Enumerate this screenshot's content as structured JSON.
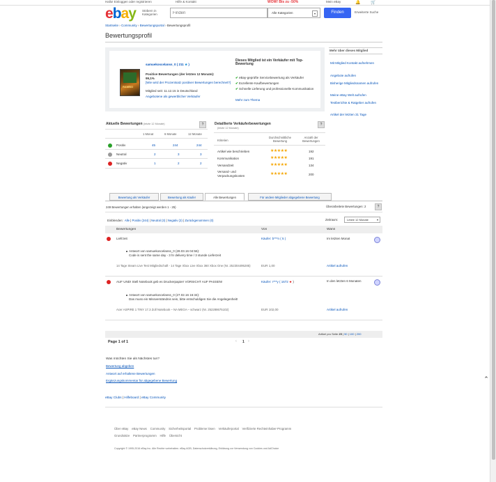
{
  "topbar": {
    "left_text": "Hallo! Einloggen oder registrieren",
    "mid_text": "Hilfe & Kontakt",
    "promo": "WOW! Bis zu -50%",
    "my_ebay": "Mein eBay"
  },
  "header": {
    "browse_label": "Stöbern in Kategorien",
    "search_placeholder": "Finden",
    "category_selected": "Alle Kategorien",
    "search_button": "Finden",
    "advanced_search": "Erweiterte Suche"
  },
  "breadcrumb": [
    "Startseite",
    "Community",
    "Bewertungsportal",
    "Bewertungsprofil"
  ],
  "page_title": "Bewertungsprofil",
  "profile": {
    "username": "samuekoscelanss_0 ( 211",
    "positive_label": "Positive Bewertungen (der letzten 12 Monate):",
    "positive_value": "99,1%",
    "positive_link": "[Wie wird der Prozentsatz positiver Bewertungen berechnet?]",
    "member_since": "Mitglied seit: 11.12.15 in Deutschland",
    "view_items": "Angebotene als gewerblicher Verkäufer",
    "top_rated_title": "Dieses Mitglied ist ein Verkäufer mit Top-Bewertung",
    "top_points": [
      "eBay-geprüfte Servicebewertung als Verkäufer",
      "Exzellente Kaufbewertungen",
      "Schnelle Lieferung und professionelle Kommunikation"
    ],
    "more_link": "Mehr zum Thema"
  },
  "more_about": {
    "title": "Mehr über dieses Mitglied",
    "links": [
      "Mit Mitglied Kontakt aufnehmen",
      "Angebote aufrufen",
      "Bisherige Mitgliedsnamen aufrufen",
      "Meine eBay Welt aufrufen",
      "Testberichte & Ratgeber aufrufen",
      "Artikel der letzten 31 Tage"
    ]
  },
  "recent": {
    "title": "Aktuelle Bewertungen",
    "subtitle": "(letzte 12 Monate)",
    "headers": [
      "1 Monat",
      "6 Monate",
      "12 Monate"
    ],
    "rows": [
      {
        "label": "Positiv",
        "v1": "45",
        "v6": "244",
        "v12": "244"
      },
      {
        "label": "Neutral",
        "v1": "2",
        "v6": "3",
        "v12": "3"
      },
      {
        "label": "Negativ",
        "v1": "1",
        "v6": "2",
        "v12": "2"
      }
    ]
  },
  "detailed": {
    "title": "Detaillierte Verkäuferbewertungen",
    "subtitle": "(letzte 12 Monate)",
    "headers": [
      "Kriterien",
      "Durchschnittliche Bewertung",
      "Anzahl der Bewertungen"
    ],
    "rows": [
      {
        "label": "Artikel wie beschrieben",
        "count": "192",
        "stars": 4.8
      },
      {
        "label": "Kommunikation",
        "count": "191",
        "stars": 4.8
      },
      {
        "label": "Versandzeit",
        "count": "134",
        "stars": 4.8
      },
      {
        "label": "Versand- und Verpackungskosten",
        "count": "200",
        "stars": 4.8
      }
    ]
  },
  "tabs": [
    "Bewertung als Verkäufer",
    "Bewertung als Käufer",
    "Alle Bewertungen",
    "Für andere Mitglieder abgegebene Bewertung"
  ],
  "listing": {
    "count_text": "249 Bewertungen erhalten (angezeigt werden 1 - 25)",
    "revised": "Überarbeitete Bewertungen: 2",
    "filter_label": "Einblenden:",
    "filters": [
      "Alle",
      "Positiv (244)",
      "Neutral (3)",
      "Negativ (2)",
      "Zurückgenommen (0)"
    ],
    "period_label": "Zeitraum:",
    "period_value": "Letzte 12 Monate",
    "col_feedback": "Bewertungen",
    "col_from": "Von",
    "col_when": "Wann"
  },
  "entries": [
    {
      "comment": "Liefrzeit",
      "from": "Käufer: b***n ( 5 )",
      "when": "Im letzten Monat",
      "reply1": "Antwort von samuekoscelanss_0 (28.03.16 04:56):",
      "reply2": "Code is sent the same day - 3 hr delivery time / 3 stunde Lieferzeit",
      "item": "14 Tage Steam Live Test Mitgliedschaft - 14 Tage Xbox Live Xbox 360 Xbox One (Nr. 252304495285)",
      "price": "EUR 1,00",
      "item_link": "Artikel aufrufen"
    },
    {
      "comment": "AUF UND! Stell Notebook geb es Druckerpapier! VORSICHT AUF PASSEN!",
      "from": "Käufer: r***y ( 1672",
      "when": "In den letzten 6 Monaten",
      "reply1": "Antwort von samuekoscelanss_0 (27.02.16 16:34):",
      "reply2": "Das muss ein Missverständnis sein, bitte entschuldigen Sie die Angelegenheit!",
      "item": "Acer ASPIRE 1 TINY 17.3 Zoll Notebook – NA MEGA – schwarz (Nr. 252288675102)",
      "price": "EUR 102,00",
      "item_link": "Artikel aufrufen"
    }
  ],
  "pager": {
    "per_page_label": "Artikel pro Seite",
    "per_page": [
      "25",
      "50",
      "100",
      "200"
    ],
    "page_text": "Page 1 of 1",
    "current": "1"
  },
  "help_section": {
    "title": "Was möchten Sie als Nächstes tun?",
    "links": [
      "Bewertung abgeben",
      "Antwort auf erhaltene Bewertungen",
      "Ergänzungskommentar für abgegebene Bewertung"
    ]
  },
  "community_links": [
    "eBay Clubs",
    "Hilfeboard",
    "eBay Community"
  ],
  "footer": {
    "row1": [
      "Über eBay",
      "eBay News",
      "Community",
      "Sicherheitsportal",
      "Probleme lösen",
      "Verkäuferportal",
      "Verifizierte Rechteinhaber-Programm"
    ],
    "row2": [
      "Grundsätze",
      "Partnerprogramm",
      "Hilfe",
      "Übersicht"
    ],
    "copyright": "Copyright © 1995-2016 eBay Inc. Alle Rechte vorbehalten. eBay AGB, Datenschutzerklärung, Erklärung zur Verwendung von Cookies und AdChoice"
  },
  "colors": {
    "link": "#0654ba",
    "promo": "#e53238",
    "button": "#3665f3",
    "positive": "#2aa02a",
    "neutral": "#999999",
    "negative": "#dd2222"
  }
}
